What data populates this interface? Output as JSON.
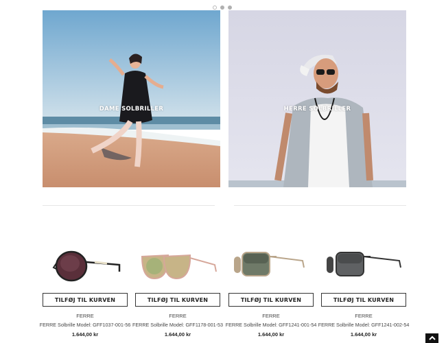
{
  "carousel": {
    "slides": 3,
    "active": 2
  },
  "banners": [
    {
      "label": "DAME SOLBRILLER"
    },
    {
      "label": "HERRE SOLBRILLER"
    }
  ],
  "products": [
    {
      "brand": "FERRE",
      "model": "FERRE Solbrille Model: GFF1037-001-56",
      "price": "1.644,00 kr",
      "button": "TILFØJ TIL KURVEN"
    },
    {
      "brand": "FERRE",
      "model": "FERRE Solbrille Model: GFF1178-001-53",
      "price": "1.644,00 kr",
      "button": "TILFØJ TIL KURVEN"
    },
    {
      "brand": "FERRE",
      "model": "FERRE Solbrille Model: GFF1241-001-54",
      "price": "1.644,00 kr",
      "button": "TILFØJ TIL KURVEN"
    },
    {
      "brand": "FERRE",
      "model": "FERRE Solbrille Model: GFF1241-002-54",
      "price": "1.644,00 kr",
      "button": "TILFØJ TIL KURVEN"
    }
  ],
  "colors": {
    "button_border": "#333333",
    "text": "#222222",
    "scroll_top_bg": "#111111"
  },
  "icons": {
    "scroll_top": "chevron-up-icon"
  }
}
